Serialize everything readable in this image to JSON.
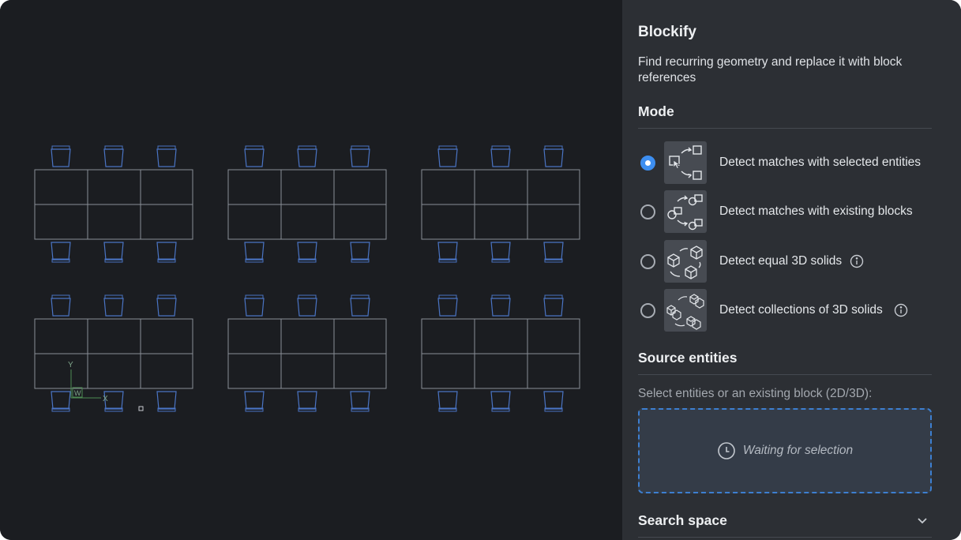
{
  "panel": {
    "title": "Blockify",
    "description": "Find recurring geometry and replace it with block references",
    "mode": {
      "heading": "Mode",
      "options": [
        {
          "label": "Detect matches with selected entities",
          "icon": "selected-entities-icon",
          "checked": true,
          "info": false
        },
        {
          "label": "Detect matches with existing blocks",
          "icon": "existing-blocks-icon",
          "checked": false,
          "info": false
        },
        {
          "label": "Detect equal 3D solids",
          "icon": "equal-solids-icon",
          "checked": false,
          "info": true
        },
        {
          "label": "Detect collections of 3D solids",
          "icon": "solid-collections-icon",
          "checked": false,
          "info": true
        }
      ]
    },
    "source": {
      "heading": "Source entities",
      "hint": "Select entities or an existing block (2D/3D):",
      "waiting": "Waiting for selection"
    },
    "search_space": {
      "heading": "Search space"
    }
  },
  "ucs": {
    "x_label": "X",
    "y_label": "Y",
    "w_label": "W"
  },
  "colors": {
    "accent": "#3d8ef0",
    "chair": "#4a74c4",
    "table": "#8a8e96",
    "ucs": "#4c8a52"
  }
}
